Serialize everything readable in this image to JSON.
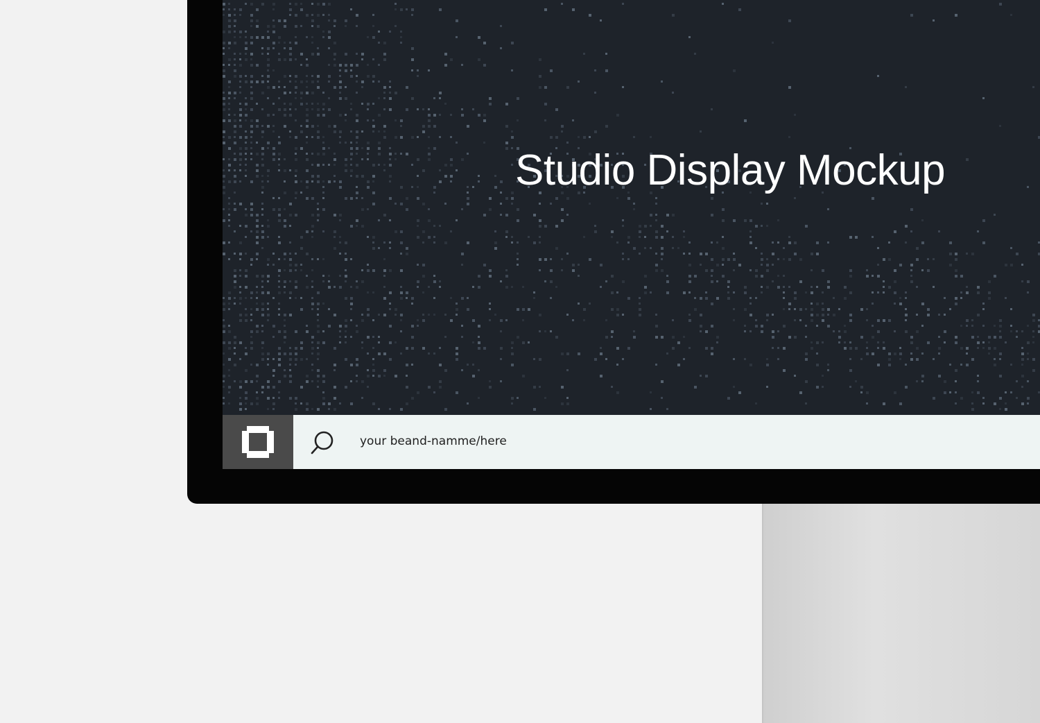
{
  "screen": {
    "headline": "Studio Display Mockup",
    "background_color": "#1e232a"
  },
  "taskbar": {
    "start_icon": "window-logo-icon",
    "search_icon": "search-icon",
    "search_text": "your beand-namme/here",
    "background_color": "#eef4f3",
    "start_background_color": "#4a4a4a"
  }
}
